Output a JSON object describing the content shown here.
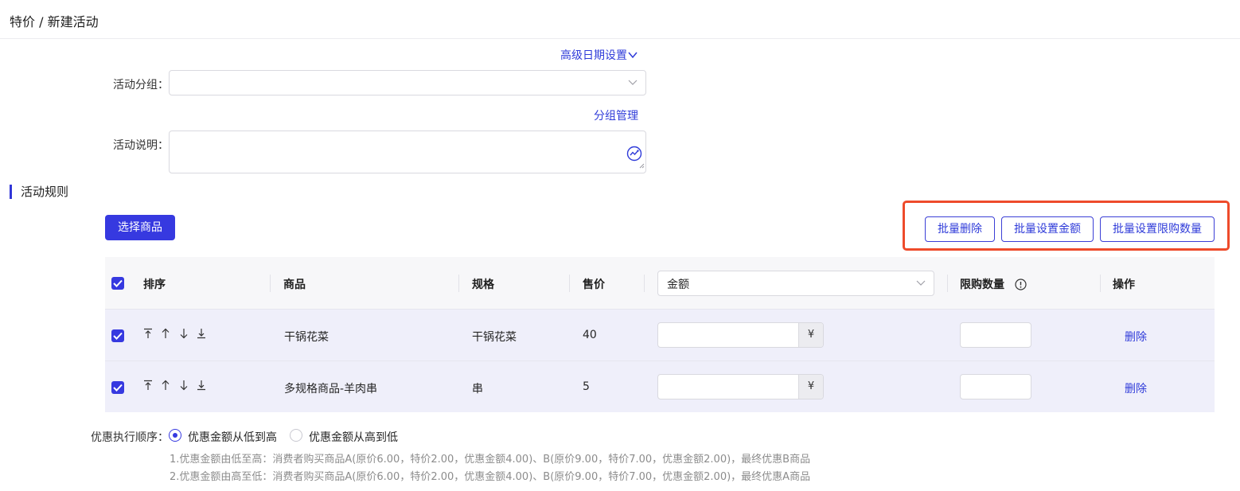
{
  "header": {
    "title": "特价 / 新建活动"
  },
  "form": {
    "advanced_date_link": "高级日期设置",
    "group_label": "活动分组：",
    "group_value": "",
    "group_manage_link": "分组管理",
    "desc_label": "活动说明：",
    "desc_value": ""
  },
  "rules": {
    "section_title": "活动规则",
    "select_goods_button": "选择商品",
    "batch_delete_button": "批量删除",
    "batch_amount_button": "批量设置金额",
    "batch_limit_button": "批量设置限购数量"
  },
  "table": {
    "columns": {
      "sort": "排序",
      "goods": "商品",
      "spec": "规格",
      "price": "售价",
      "amount_select": "金额",
      "limit": "限购数量",
      "action": "操作"
    },
    "currency_suffix": "¥",
    "delete_label": "删除",
    "rows": [
      {
        "goods": "干锅花菜",
        "spec": "干锅花菜",
        "price": "40",
        "amount": "",
        "limit": ""
      },
      {
        "goods": "多规格商品-羊肉串",
        "spec": "串",
        "price": "5",
        "amount": "",
        "limit": ""
      }
    ]
  },
  "order": {
    "label": "优惠执行顺序：",
    "options": [
      "优惠金额从低到高",
      "优惠金额从高到低"
    ],
    "selected_index": 0,
    "notes": [
      "1.优惠金额由低至高：消费者购买商品A(原价6.00，特价2.00，优惠金额4.00)、B(原价9.00，特价7.00，优惠金额2.00)，最终优惠B商品",
      "2.优惠金额由高至低：消费者购买商品A(原价6.00，特价2.00，优惠金额4.00)、B(原价9.00，特价7.00，优惠金额2.00)，最终优惠A商品"
    ]
  },
  "colors": {
    "primary": "#3639e0",
    "link": "#2f3bd9",
    "highlight": "#ee4b2b",
    "row_bg": "#efeffa"
  }
}
